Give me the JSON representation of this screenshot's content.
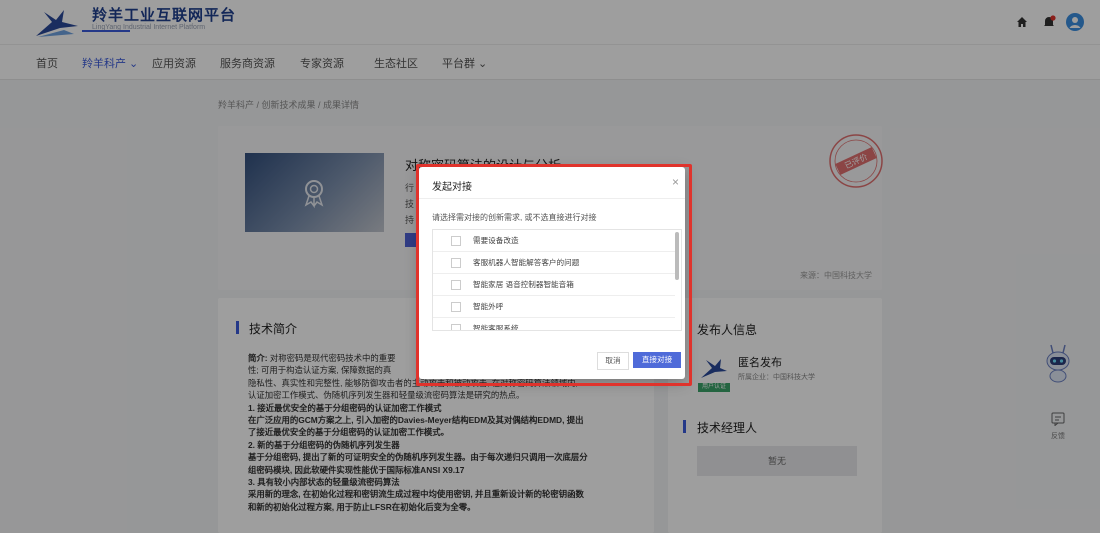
{
  "header": {
    "logo_title": "羚羊工业互联网平台",
    "logo_subtitle": "LingYang Industrial Internet Platform",
    "icons": [
      "home-icon",
      "bell-icon",
      "user-avatar-icon"
    ],
    "brand_color": "#3b5bdb"
  },
  "nav": {
    "items": [
      "首页",
      "羚羊科产 ⌄",
      "应用资源",
      "服务商资源",
      "专家资源",
      "生态社区",
      "平台群 ⌄"
    ],
    "active_index": 1
  },
  "breadcrumb": "羚羊科产 / 创新技术成果 / 成果详情",
  "hero": {
    "title": "对称密码算法的设计与分析",
    "line1": "行",
    "line2": "技",
    "line3": "持",
    "source": "来源：中国科技大学",
    "stamp_text": "已评价"
  },
  "intro": {
    "title": "技术简介",
    "p1_label": "简介:",
    "p1": " 对称密码是现代密码技术中的重要",
    "p1b": "性; 可用于构造认证方案, 保障数据的真",
    "p1c": "隐私性、真实性和完整性, 能够防御攻击者的主动攻击和被动攻击, 在对称密码算法领域内,",
    "p1d": "认证加密工作模式、伪随机序列发生器和轻量级流密码算法是研究的热点。",
    "h1": "1. 接近最优安全的基于分组密码的认证加密工作模式",
    "t1": "在广泛应用的GCM方案之上, 引入加密的Davies-Meyer结构EDM及其对偶结构EDMD, 提出",
    "t1b": "了接近最优安全的基于分组密码的认证加密工作模式。",
    "h2": "2. 新的基于分组密码的伪随机序列发生器",
    "t2": "基于分组密码, 提出了新的可证明安全的伪随机序列发生器。由于每次递归只调用一次底层分",
    "t2b": "组密码模块, 因此软硬件实现性能优于国际标准ANSI X9.17",
    "h3": "3. 具有较小内部状态的轻量级流密码算法",
    "t3": "采用新的理念, 在初始化过程和密钥流生成过程中均使用密钥, 并且重新设计新的轮密钥函数",
    "t3b": "和新的初始化过程方案, 用于防止LFSR在初始化后变为全零。"
  },
  "publisher": {
    "title": "发布人信息",
    "name": "匿名发布",
    "org": "所属企业：中国科技大学",
    "badge": "用户认证"
  },
  "manager": {
    "title": "技术经理人",
    "empty": "暂无"
  },
  "feedback": {
    "label": "反馈"
  },
  "modal": {
    "title": "发起对接",
    "close": "×",
    "description": "请选择需对接的创新需求, 或不选直接进行对接",
    "options": [
      "需要设备改造",
      "客服机器人智能解答客户的问题",
      "智能家居 语音控制器智能音箱",
      "智能外呼",
      "智能客服系统"
    ],
    "cancel_label": "取消",
    "confirm_label": "直接对接",
    "highlight_color": "#e0332c"
  }
}
